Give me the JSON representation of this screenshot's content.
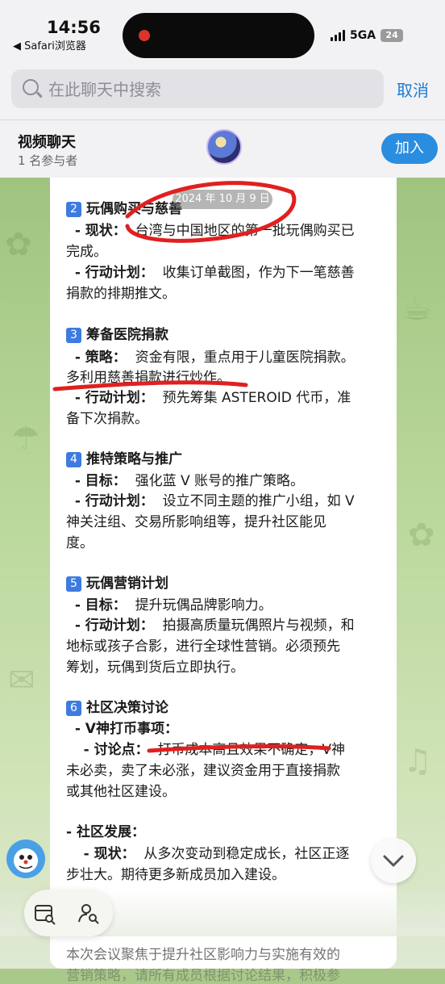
{
  "status_bar": {
    "time": "14:56",
    "back_app": "◀ Safari浏览器",
    "network": "5GA",
    "battery": "24"
  },
  "search": {
    "placeholder": "在此聊天中搜索",
    "cancel_label": "取消"
  },
  "chat": {
    "title": "视频聊天",
    "participants": "1 名参与者",
    "join_label": "加入"
  },
  "date_pill": "2024 年 10 月 9 日",
  "message": {
    "s2_title": "玩偶购买与慈善",
    "s2_status_label": "- 现状：",
    "s2_status_text": "台湾与中国地区的第一批玩偶购买已",
    "s2_status_cont": "完成。",
    "s2_plan_label": "- 行动计划：",
    "s2_plan_text": "收集订单截图，作为下一笔慈善",
    "s2_plan_cont": "捐款的排期推文。",
    "s3_title": "筹备医院捐款",
    "s3_strategy_label": "- 策略：",
    "s3_strategy_text": "资金有限，重点用于儿童医院捐款。",
    "s3_strategy_cont": "多利用慈善捐款进行炒作。",
    "s3_plan_label": "- 行动计划：",
    "s3_plan_text": "预先筹集 ASTEROID 代币，准",
    "s3_plan_cont": "备下次捐款。",
    "s4_title": "推特策略与推广",
    "s4_goal_label": "- 目标：",
    "s4_goal_text": "强化蓝 V 账号的推广策略。",
    "s4_plan_label": "- 行动计划：",
    "s4_plan_text": "设立不同主题的推广小组，如 V",
    "s4_plan_cont1": "神关注组、交易所影响组等，提升社区能见",
    "s4_plan_cont2": "度。",
    "s5_title": "玩偶营销计划",
    "s5_goal_label": "- 目标：",
    "s5_goal_text": "提升玩偶品牌影响力。",
    "s5_plan_label": "- 行动计划：",
    "s5_plan_text": "拍摄高质量玩偶照片与视频，和",
    "s5_plan_cont1": "地标或孩子合影，进行全球性营销。必须预先",
    "s5_plan_cont2": "筹划，玩偶到货后立即执行。",
    "s6_title": "社区决策讨论",
    "s6_sub": "- V神打币事项：",
    "s6_point_label": "- 讨论点：",
    "s6_point_text": "打币成本高且效果不确定，V神",
    "s6_point_cont1": "未必卖，卖了未必涨，建议资金用于直接捐款",
    "s6_point_cont2": "或其他社区建设。",
    "s7_title": "- 社区发展：",
    "s7_status_label": "- 现状：",
    "s7_status_text": "从多次变动到稳定成长，社区正逐",
    "s7_status_cont": "步壮大。期待更多新成员加入建设。",
    "summary_line1": "本次会议聚焦于提升社区影响力与实施有效的",
    "summary_line2": "营销策略，请所有成员根据讨论结果，积极参"
  },
  "numbers": {
    "n2": "2",
    "n3": "3",
    "n4": "4",
    "n5": "5",
    "n6": "6"
  },
  "colors": {
    "accent": "#1a7bd6",
    "join_button": "#2a8de0",
    "number_badge": "#3d7be0",
    "annotation": "#e02020"
  },
  "icons": [
    "search-icon",
    "calendar-search-icon",
    "member-search-icon",
    "chevron-down-icon",
    "sticker-avatar",
    "chat-avatar"
  ]
}
